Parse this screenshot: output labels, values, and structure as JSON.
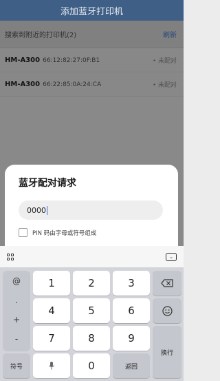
{
  "header": {
    "title": "添加蓝牙打印机"
  },
  "list": {
    "section_title": "搜索到附近的打印机(2)",
    "refresh_label": "刷新",
    "devices": [
      {
        "name": "HM-A300",
        "mac": "66:12:82:27:0F:B1",
        "status": "• 未配对"
      },
      {
        "name": "HM-A300",
        "mac": "66:22:85:0A:24:CA",
        "status": "• 未配对"
      }
    ]
  },
  "dialog": {
    "title": "蓝牙配对请求",
    "pin_value": "0000",
    "checkbox_label": "PIN 码由字母或符号组成"
  },
  "keyboard": {
    "symbols": [
      "@",
      ".",
      "+",
      "-"
    ],
    "digits": [
      "1",
      "2",
      "3",
      "4",
      "5",
      "6",
      "7",
      "8",
      "9"
    ],
    "zero": "0",
    "symbol_key": "符号",
    "back_key": "返回",
    "enter_key": "换行",
    "icons": [
      "grid-icon",
      "hide-keyboard-icon",
      "backspace-icon",
      "emoji-icon",
      "mic-icon"
    ]
  }
}
